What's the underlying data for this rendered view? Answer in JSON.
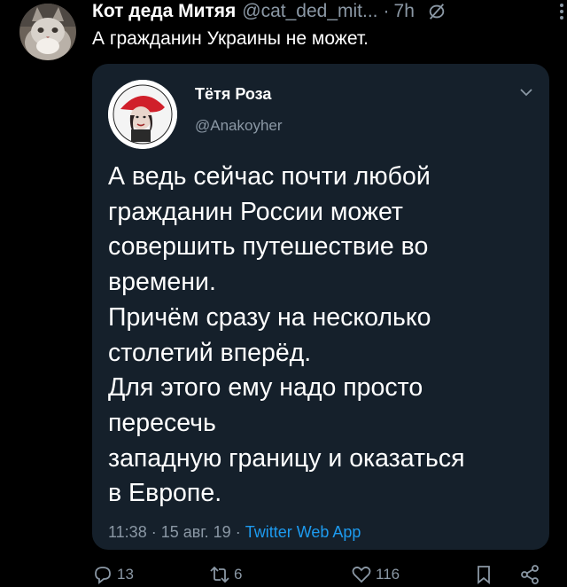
{
  "tweet": {
    "author_name": "Кот деда Митяя",
    "author_handle": "@cat_ded_mit...",
    "separator": "·",
    "time": "7h",
    "text": "А гражданин Украины не может."
  },
  "quote": {
    "author_name": "Тётя Роза",
    "author_handle": "@Anakoyher",
    "text_lines": [
      "А ведь сейчас почти любой",
      "гражданин России может",
      "совершить путешествие во",
      "времени.",
      "Причём сразу на несколько",
      "столетий вперёд.",
      "Для этого ему надо просто",
      "пересечь",
      "западную границу и оказаться",
      "в Европе."
    ],
    "timestamp": "11:38 · 15 авг. 19 · ",
    "source": "Twitter Web App"
  },
  "actions": {
    "replies": "13",
    "retweets": "6",
    "likes": "116"
  },
  "colors": {
    "background": "#000000",
    "card": "#15202b",
    "secondary_text": "#8b98a5",
    "link": "#1d9bf0"
  },
  "icons": {
    "edit_disabled": "pencil-off-icon",
    "more": "more-vertical-icon",
    "chevron": "chevron-down-icon",
    "reply": "reply-icon",
    "retweet": "retweet-icon",
    "like": "heart-icon",
    "bookmark": "bookmark-icon",
    "share": "share-icon"
  }
}
